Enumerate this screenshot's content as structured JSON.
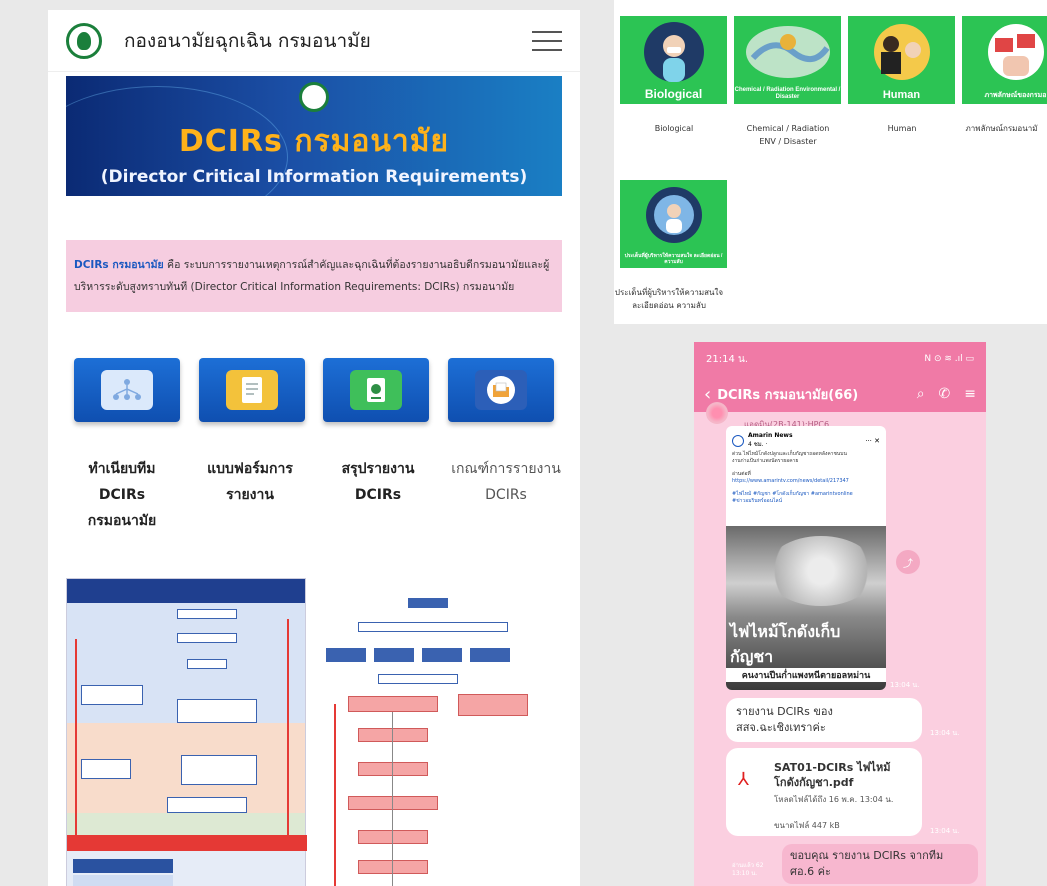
{
  "site": {
    "title": "กองอนามัยฉุกเฉิน กรมอนามัย",
    "banner_title": "DCIRs กรมอนามัย",
    "banner_subtitle": "(Director Critical Information Requirements)",
    "intro_brand": "DCIRs กรมอนามัย",
    "intro_text": " คือ ระบบการรายงานเหตุการณ์สำคัญและฉุกเฉินที่ต้องรายงานอธิบดีกรมอนามัยและผู้บริหารระดับสูงทราบทันที (Director Critical Information Requirements: DCIRs) กรมอนามัย",
    "cards": [
      {
        "label_line1": "ทำเนียบทีม DCIRs",
        "label_line2": "กรมอนามัย",
        "icon": "network-icon",
        "icon_color": "#8fb8e8"
      },
      {
        "label_line1": "แบบฟอร์มการ",
        "label_line2": "รายงาน",
        "icon": "form-icon",
        "icon_color": "#f3c23b"
      },
      {
        "label_line1": "สรุปรายงาน",
        "label_line2": "DCIRs",
        "icon": "summary-icon",
        "icon_color": "#3fbf5a"
      },
      {
        "label_line1": "เกณฑ์การรายงาน",
        "label_line2": "DCIRs",
        "icon": "folder-icon",
        "icon_color": "#f0a33a"
      }
    ]
  },
  "categories": {
    "tiles": [
      {
        "tile_title": "Biological",
        "caption": "Biological",
        "icon": "biohazard-person-icon"
      },
      {
        "tile_title": "Chemical / Radiation Environmental / Disaster",
        "caption": "Chemical / Radiation ENV / Disaster",
        "icon": "disaster-map-icon"
      },
      {
        "tile_title": "Human",
        "caption": "Human",
        "icon": "human-incident-icon"
      },
      {
        "tile_title": "ภาพลักษณ์ของกรมอ",
        "caption": "ภาพลักษณ์กรมอนามั",
        "icon": "image-megaphone-icon"
      },
      {
        "tile_title": "ประเด็นที่ผู้บริหารให้ความสนใจ ละเอียดอ่อน / ความลับ",
        "caption": "ประเด็นที่ผู้บริหารให้ความสนใจ ละเอียดอ่อน ความลับ",
        "icon": "executive-globe-icon"
      }
    ]
  },
  "phone": {
    "status_time": "21:14 น.",
    "status_right": "N ⊙ ≋ .ıl ▭",
    "chat_title": "DCIRs กรมอนามัย(66)",
    "sender": "แอดมิน(2B-141):HPC6",
    "news": {
      "source": "Amarin News",
      "source_sub": "4 ชม. ·",
      "line1": "ด่วน ไฟไหม้โกดังปลูกและเก็บกัญชาถอดหลังคาชนบน",
      "line2": "งานก่าแป้นก่าแพงนัดรายอคาย",
      "read_more": "อ่านต่อที่",
      "link": "https://www.amarintv.com/news/detail/217347",
      "tags": "#ไฟไหม้ #กัญชา #โกดังเก็บกัญชา #amarintvonline",
      "tags2": "#ข่าวอมรินทร์ออนไลน์",
      "headline": "ไฟไหม้โกดังเก็บกัญชา",
      "subline": "คนงานปีนก่ำแพงหนีตายอลหม่าน",
      "time": "13:04 น."
    },
    "msg_text": "รายงาน DCIRs ของ สสจ.ฉะเชิงเทราค่ะ",
    "msg_text_time": "13:04 น.",
    "file_name": "SAT01-DCIRs ไฟไหม้ โกดังกัญชา.pdf",
    "file_expire": "โหลดไฟล์ได้ถึง 16 พ.ค. 13:04 น.",
    "file_size": "ขนาดไฟล์ 447 kB",
    "file_time": "13:04 น.",
    "msg_mine": "ขอบคุณ รายงาน DCIRs จากทีม ศอ.6 ค่ะ",
    "read_count": "อ่านแล้ว 62",
    "mine_time": "13:10 น."
  }
}
